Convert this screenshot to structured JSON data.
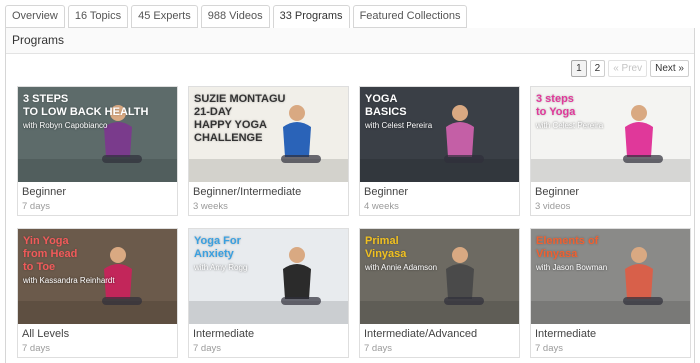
{
  "tabs": [
    {
      "label": "Overview"
    },
    {
      "label": "16 Topics"
    },
    {
      "label": "45 Experts"
    },
    {
      "label": "988 Videos"
    },
    {
      "label": "33 Programs"
    },
    {
      "label": "Featured Collections"
    }
  ],
  "active_tab": "33 Programs",
  "section": {
    "title": "Programs"
  },
  "pagination": {
    "pages": [
      "1",
      "2"
    ],
    "current": "1",
    "prev": "« Prev",
    "next": "Next »"
  },
  "programs": [
    {
      "level": "Beginner",
      "duration": "7 days",
      "thumb": {
        "lines": [
          "3 STEPS",
          "TO LOW BACK HEALTH"
        ],
        "sub": "with Robyn Capobianco",
        "text_color": "#ffffff",
        "bg": "#5d6b6a",
        "accent": "#7a3b8c"
      }
    },
    {
      "level": "Beginner/Intermediate",
      "duration": "3 weeks",
      "thumb": {
        "lines": [
          "SUZIE MONTAGU",
          "21-DAY",
          "HAPPY YOGA",
          "CHALLENGE"
        ],
        "sub": "",
        "text_color": "#333333",
        "bg": "#f1efe9",
        "accent": "#2a63b8"
      }
    },
    {
      "level": "Beginner",
      "duration": "4 weeks",
      "thumb": {
        "lines": [
          "YOGA",
          "BASICS"
        ],
        "sub": "with Celest Pereira",
        "text_color": "#ffffff",
        "bg": "#3a3f46",
        "accent": "#c45fa6"
      }
    },
    {
      "level": "Beginner",
      "duration": "3 videos",
      "thumb": {
        "lines": [
          "3 steps",
          "to Yoga"
        ],
        "sub": "with Celest Pereira",
        "text_color": "#e0389a",
        "bg": "#f4f4f2",
        "accent": "#e0389a"
      }
    },
    {
      "level": "All Levels",
      "duration": "7 days",
      "thumb": {
        "lines": [
          "Yin Yoga",
          "from Head",
          "to Toe"
        ],
        "sub": "with Kassandra Reinhardt",
        "text_color": "#f05a5a",
        "bg": "#6b5a4b",
        "accent": "#c2265a"
      }
    },
    {
      "level": "Intermediate",
      "duration": "7 days",
      "thumb": {
        "lines": [
          "Yoga For",
          "Anxiety"
        ],
        "sub": "with Amy Rogg",
        "text_color": "#3aa0e0",
        "bg": "#e8ebee",
        "accent": "#2b2b2b"
      }
    },
    {
      "level": "Intermediate/Advanced",
      "duration": "7 days",
      "thumb": {
        "lines": [
          "Primal",
          "Vinyasa"
        ],
        "sub": "with Annie Adamson",
        "text_color": "#f0c020",
        "bg": "#6d6a62",
        "accent": "#4a4a4a"
      }
    },
    {
      "level": "Intermediate",
      "duration": "7 days",
      "thumb": {
        "lines": [
          "Elements of",
          "Vinyasa"
        ],
        "sub": "with Jason Bowman",
        "text_color": "#f06030",
        "bg": "#8a8a88",
        "accent": "#d8604a"
      }
    }
  ]
}
